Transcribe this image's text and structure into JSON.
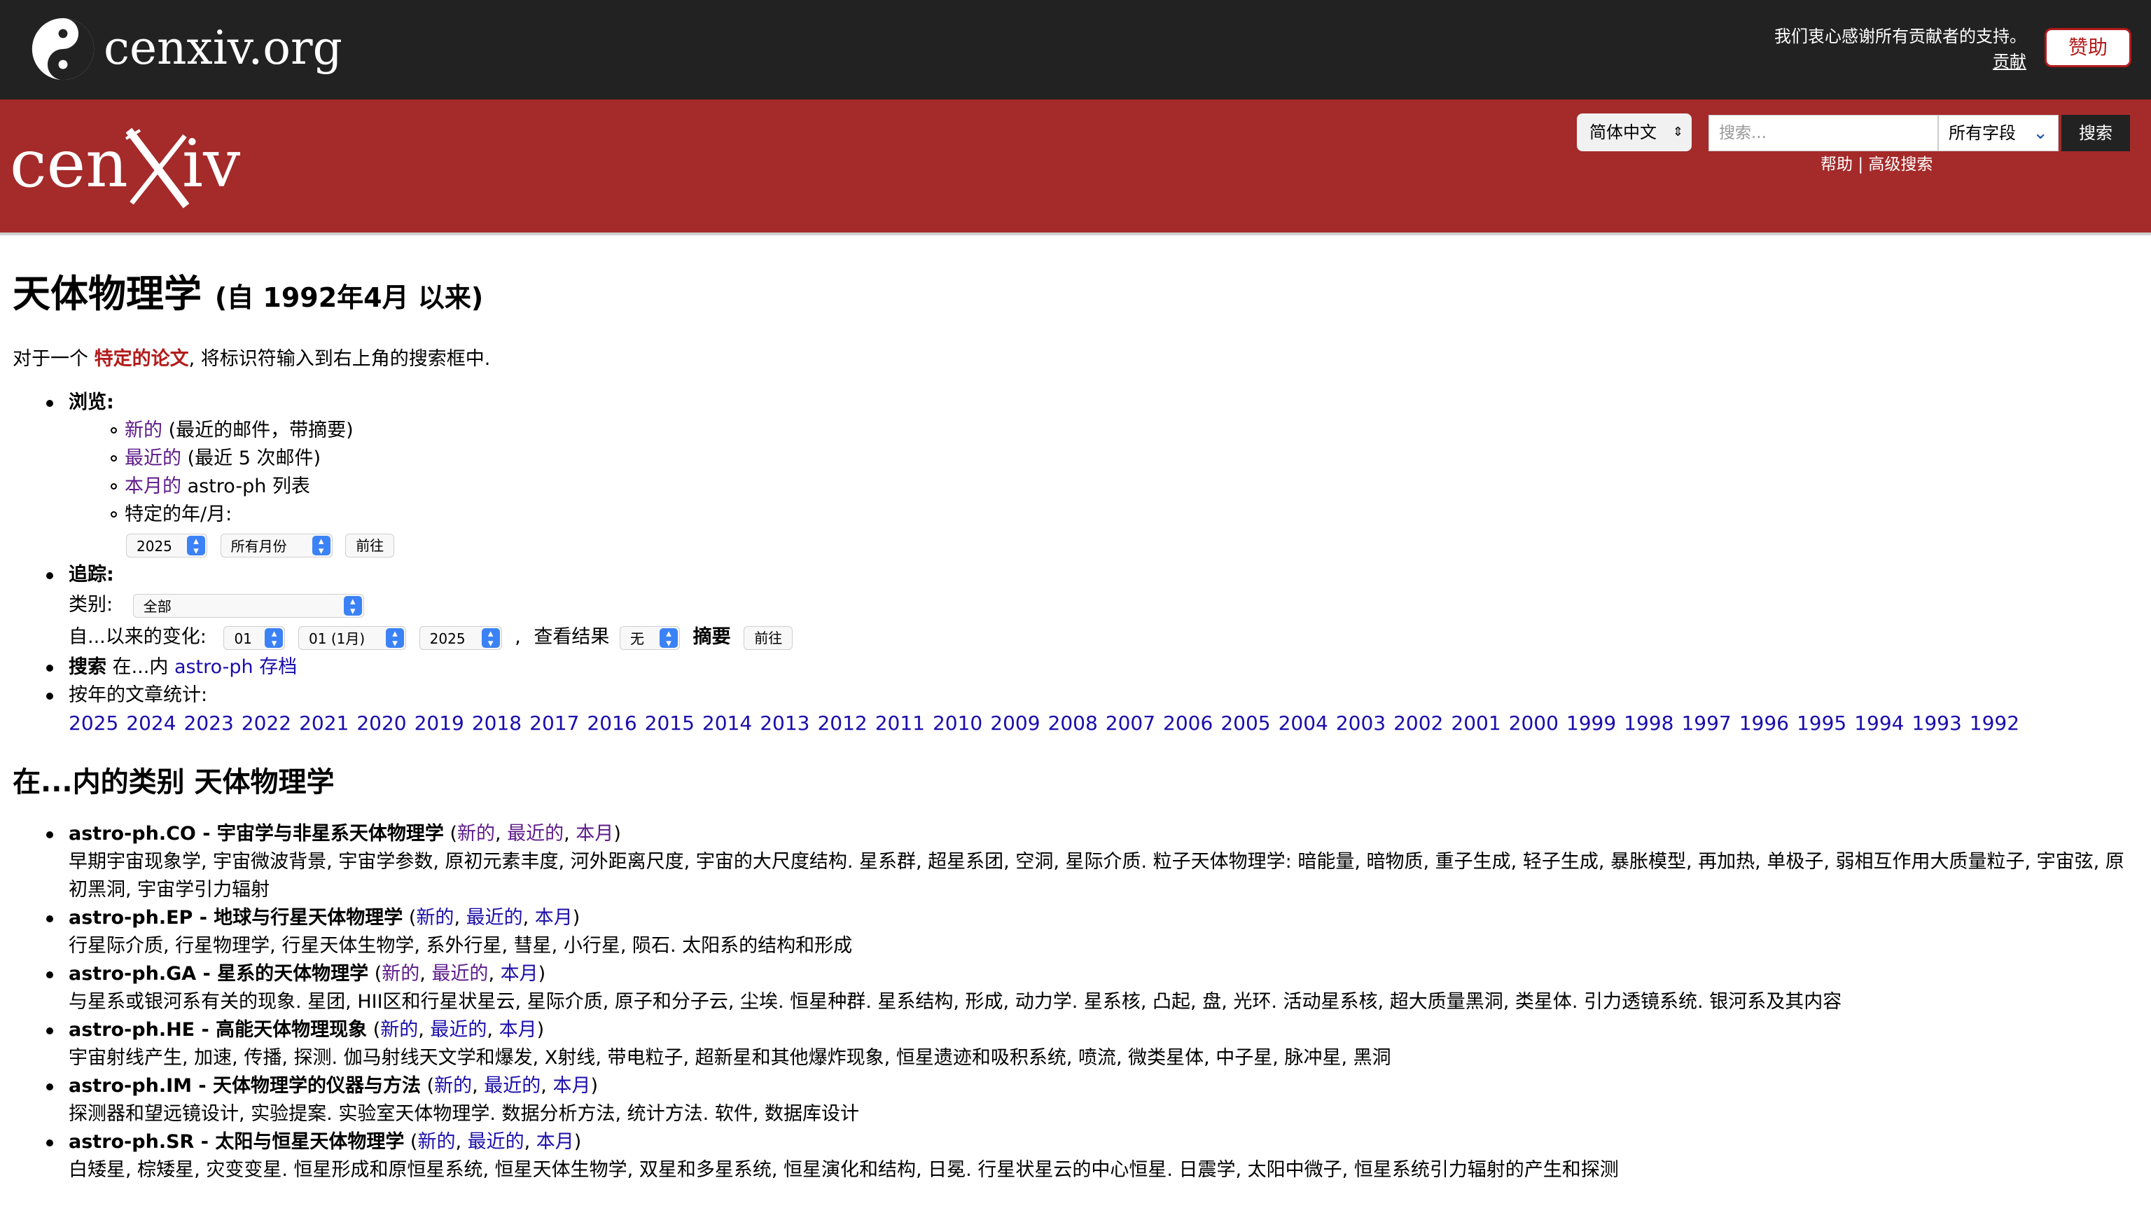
{
  "header": {
    "brand": "cenxiv.org",
    "thanks_text": "我们衷心感谢所有贡献者的支持。",
    "contribute_link": "贡献",
    "donate_label": "赞助"
  },
  "banner": {
    "logo_text": "cenxiv",
    "language": "简体中文",
    "search_placeholder": "搜索...",
    "field_option": "所有字段",
    "search_button": "搜索",
    "help_link": "帮助",
    "separator": "|",
    "advanced_link": "高级搜索"
  },
  "page": {
    "title": "天体物理学",
    "title_suffix": "(自 1992年4月 以来)",
    "intro_before": "对于一个",
    "intro_link": "特定的论文",
    "intro_after": ", 将标识符输入到右上角的搜索框中."
  },
  "browse": {
    "label": "浏览:",
    "new_link": "新的",
    "new_desc": "(最近的邮件，带摘要)",
    "recent_link": "最近的",
    "recent_desc": "(最近 5 次邮件)",
    "month_link": "本月的",
    "month_desc": "astro-ph 列表",
    "specific_label": "特定的年/月:",
    "year_value": "2025",
    "month_value": "所有月份",
    "go_label": "前往"
  },
  "catchup": {
    "label": "追踪:",
    "category_label": "类别:",
    "category_value": "全部",
    "since_label": "自...以来的变化:",
    "day_value": "01",
    "month_value": "01 (1月)",
    "year_value": "2025",
    "comma": ",",
    "view_label": "查看结果",
    "abstract_value": "无",
    "abstract_label": "摘要",
    "go_label": "前往"
  },
  "search_archive": {
    "bold": "搜索",
    "text": "在...内",
    "link": "astro-ph 存档"
  },
  "stats": {
    "label": "按年的文章统计:",
    "years": [
      "2025",
      "2024",
      "2023",
      "2022",
      "2021",
      "2020",
      "2019",
      "2018",
      "2017",
      "2016",
      "2015",
      "2014",
      "2013",
      "2012",
      "2011",
      "2010",
      "2009",
      "2008",
      "2007",
      "2006",
      "2005",
      "2004",
      "2003",
      "2002",
      "2001",
      "2000",
      "1999",
      "1998",
      "1997",
      "1996",
      "1995",
      "1994",
      "1993",
      "1992"
    ]
  },
  "categories_heading": "在...内的类别 天体物理学",
  "categories": [
    {
      "name": "astro-ph.CO - 宇宙学与非星系天体物理学",
      "new": "新的",
      "recent": "最近的",
      "month": "本月",
      "desc": "早期宇宙现象学, 宇宙微波背景, 宇宙学参数, 原初元素丰度, 河外距离尺度, 宇宙的大尺度结构. 星系群, 超星系团, 空洞, 星际介质. 粒子天体物理学: 暗能量, 暗物质, 重子生成, 轻子生成, 暴胀模型, 再加热, 单极子, 弱相互作用大质量粒子, 宇宙弦, 原初黑洞, 宇宙学引力辐射"
    },
    {
      "name": "astro-ph.EP - 地球与行星天体物理学",
      "new": "新的",
      "recent": "最近的",
      "month": "本月",
      "desc": "行星际介质, 行星物理学, 行星天体生物学, 系外行星, 彗星, 小行星, 陨石. 太阳系的结构和形成"
    },
    {
      "name": "astro-ph.GA - 星系的天体物理学",
      "new": "新的",
      "recent": "最近的",
      "month": "本月",
      "desc": "与星系或银河系有关的现象. 星团, HII区和行星状星云, 星际介质, 原子和分子云, 尘埃. 恒星种群. 星系结构, 形成, 动力学. 星系核, 凸起, 盘, 光环. 活动星系核, 超大质量黑洞, 类星体. 引力透镜系统. 银河系及其内容"
    },
    {
      "name": "astro-ph.HE - 高能天体物理现象",
      "new": "新的",
      "recent": "最近的",
      "month": "本月",
      "desc": "宇宙射线产生, 加速, 传播, 探测. 伽马射线天文学和爆发, X射线, 带电粒子, 超新星和其他爆炸现象, 恒星遗迹和吸积系统, 喷流, 微类星体, 中子星, 脉冲星, 黑洞"
    },
    {
      "name": "astro-ph.IM - 天体物理学的仪器与方法",
      "new": "新的",
      "recent": "最近的",
      "month": "本月",
      "desc": "探测器和望远镜设计, 实验提案. 实验室天体物理学. 数据分析方法, 统计方法. 软件, 数据库设计"
    },
    {
      "name": "astro-ph.SR - 太阳与恒星天体物理学",
      "new": "新的",
      "recent": "最近的",
      "month": "本月",
      "desc": "白矮星, 棕矮星, 灾变变星. 恒星形成和原恒星系统, 恒星天体生物学, 双星和多星系统, 恒星演化和结构, 日冕. 行星状星云的中心恒星. 日震学, 太阳中微子, 恒星系统引力辐射的产生和探测"
    }
  ],
  "colors": {
    "top_bar": "#222222",
    "banner": "#a52a2a",
    "link": "#1a0dab",
    "visited_link": "#5d1a8a",
    "accent_red": "#b31b1b"
  }
}
